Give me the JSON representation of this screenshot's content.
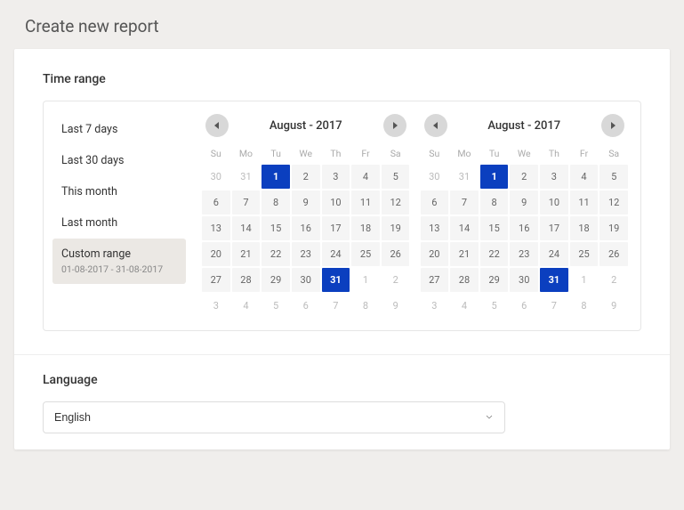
{
  "page": {
    "title": "Create new report"
  },
  "sections": {
    "time_range": "Time range",
    "language": "Language"
  },
  "presets": [
    {
      "label": "Last 7 days"
    },
    {
      "label": "Last 30 days"
    },
    {
      "label": "This month"
    },
    {
      "label": "Last month"
    },
    {
      "label": "Custom range",
      "sub": "01-08-2017 - 31-08-2017",
      "active": true
    }
  ],
  "dow": [
    "Su",
    "Mo",
    "Tu",
    "We",
    "Th",
    "Fr",
    "Sa"
  ],
  "calendars": [
    {
      "title": "August - 2017",
      "weeks": [
        [
          {
            "d": "30",
            "m": true
          },
          {
            "d": "31",
            "m": true
          },
          {
            "d": "1",
            "s": true
          },
          {
            "d": "2"
          },
          {
            "d": "3"
          },
          {
            "d": "4"
          },
          {
            "d": "5"
          }
        ],
        [
          {
            "d": "6"
          },
          {
            "d": "7"
          },
          {
            "d": "8"
          },
          {
            "d": "9"
          },
          {
            "d": "10"
          },
          {
            "d": "11"
          },
          {
            "d": "12"
          }
        ],
        [
          {
            "d": "13"
          },
          {
            "d": "14"
          },
          {
            "d": "15"
          },
          {
            "d": "16"
          },
          {
            "d": "17"
          },
          {
            "d": "18"
          },
          {
            "d": "19"
          }
        ],
        [
          {
            "d": "20"
          },
          {
            "d": "21"
          },
          {
            "d": "22"
          },
          {
            "d": "23"
          },
          {
            "d": "24"
          },
          {
            "d": "25"
          },
          {
            "d": "26"
          }
        ],
        [
          {
            "d": "27"
          },
          {
            "d": "28"
          },
          {
            "d": "29"
          },
          {
            "d": "30"
          },
          {
            "d": "31",
            "s": true
          },
          {
            "d": "1",
            "m": true
          },
          {
            "d": "2",
            "m": true
          }
        ],
        [
          {
            "d": "3",
            "m": true
          },
          {
            "d": "4",
            "m": true
          },
          {
            "d": "5",
            "m": true
          },
          {
            "d": "6",
            "m": true
          },
          {
            "d": "7",
            "m": true
          },
          {
            "d": "8",
            "m": true
          },
          {
            "d": "9",
            "m": true
          }
        ]
      ]
    },
    {
      "title": "August - 2017",
      "weeks": [
        [
          {
            "d": "30",
            "m": true
          },
          {
            "d": "31",
            "m": true
          },
          {
            "d": "1",
            "s": true
          },
          {
            "d": "2"
          },
          {
            "d": "3"
          },
          {
            "d": "4"
          },
          {
            "d": "5"
          }
        ],
        [
          {
            "d": "6"
          },
          {
            "d": "7"
          },
          {
            "d": "8"
          },
          {
            "d": "9"
          },
          {
            "d": "10"
          },
          {
            "d": "11"
          },
          {
            "d": "12"
          }
        ],
        [
          {
            "d": "13"
          },
          {
            "d": "14"
          },
          {
            "d": "15"
          },
          {
            "d": "16"
          },
          {
            "d": "17"
          },
          {
            "d": "18"
          },
          {
            "d": "19"
          }
        ],
        [
          {
            "d": "20"
          },
          {
            "d": "21"
          },
          {
            "d": "22"
          },
          {
            "d": "23"
          },
          {
            "d": "24"
          },
          {
            "d": "25"
          },
          {
            "d": "26"
          }
        ],
        [
          {
            "d": "27"
          },
          {
            "d": "28"
          },
          {
            "d": "29"
          },
          {
            "d": "30"
          },
          {
            "d": "31",
            "s": true
          },
          {
            "d": "1",
            "m": true
          },
          {
            "d": "2",
            "m": true
          }
        ],
        [
          {
            "d": "3",
            "m": true
          },
          {
            "d": "4",
            "m": true
          },
          {
            "d": "5",
            "m": true
          },
          {
            "d": "6",
            "m": true
          },
          {
            "d": "7",
            "m": true
          },
          {
            "d": "8",
            "m": true
          },
          {
            "d": "9",
            "m": true
          }
        ]
      ]
    }
  ],
  "language": {
    "selected": "English"
  }
}
